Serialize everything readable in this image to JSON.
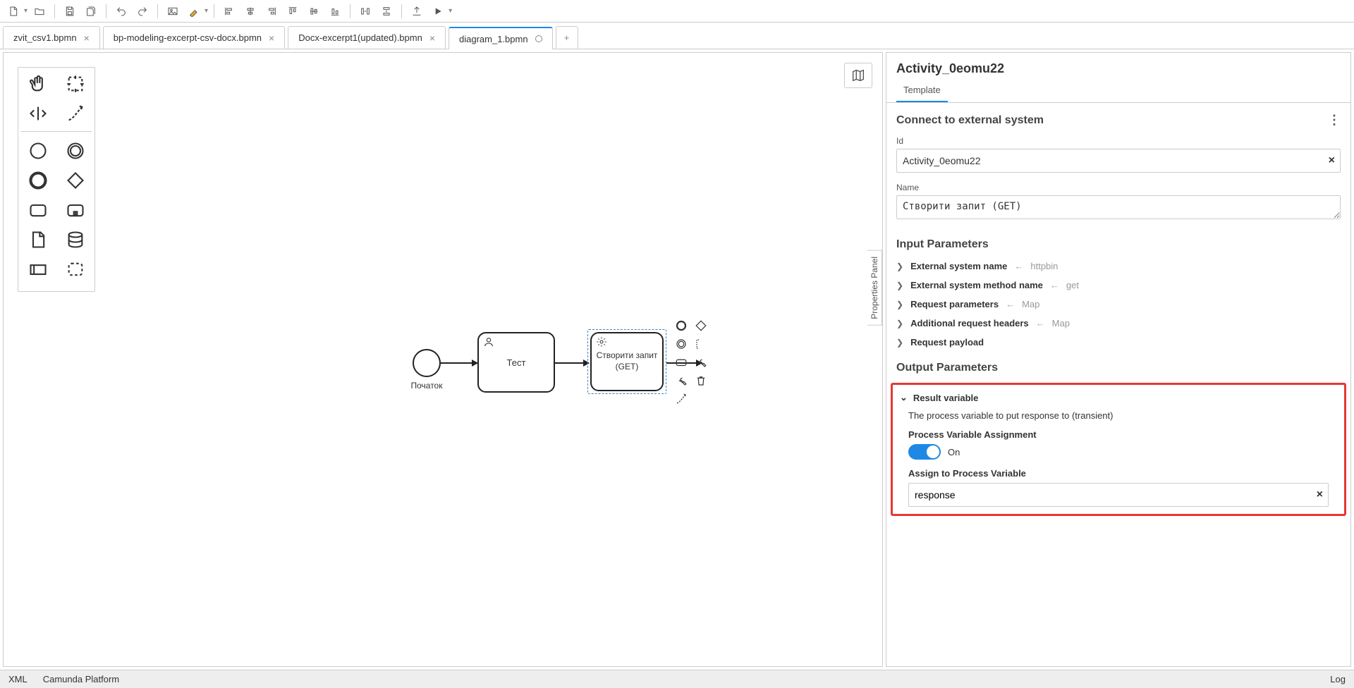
{
  "tabs": [
    {
      "label": "zvit_csv1.bpmn"
    },
    {
      "label": "bp-modeling-excerpt-csv-docx.bpmn"
    },
    {
      "label": "Docx-excerpt1(updated).bpmn"
    },
    {
      "label": "diagram_1.bpmn"
    }
  ],
  "canvas": {
    "start_label": "Початок",
    "task1_label": "Тест",
    "task2_line1": "Створити запит",
    "task2_line2": "(GET)",
    "pp_tab": "Properties Panel"
  },
  "panel": {
    "title": "Activity_0eomu22",
    "tab": "Template",
    "sect_connect": "Connect to external system",
    "id_label": "Id",
    "id_value": "Activity_0eomu22",
    "name_label": "Name",
    "name_value": "Створити запит (GET)",
    "sect_input": "Input Parameters",
    "params": [
      {
        "name": "External system name",
        "val": "httpbin"
      },
      {
        "name": "External system method name",
        "val": "get"
      },
      {
        "name": "Request parameters",
        "val": "Map"
      },
      {
        "name": "Additional request headers",
        "val": "Map"
      },
      {
        "name": "Request payload",
        "val": ""
      }
    ],
    "sect_output": "Output Parameters",
    "result_var": "Result variable",
    "result_desc": "The process variable to put response to (transient)",
    "pva_label": "Process Variable Assignment",
    "pva_on": "On",
    "assign_label": "Assign to Process Variable",
    "assign_value": "response"
  },
  "footer": {
    "xml": "XML",
    "platform": "Camunda Platform",
    "log": "Log"
  }
}
